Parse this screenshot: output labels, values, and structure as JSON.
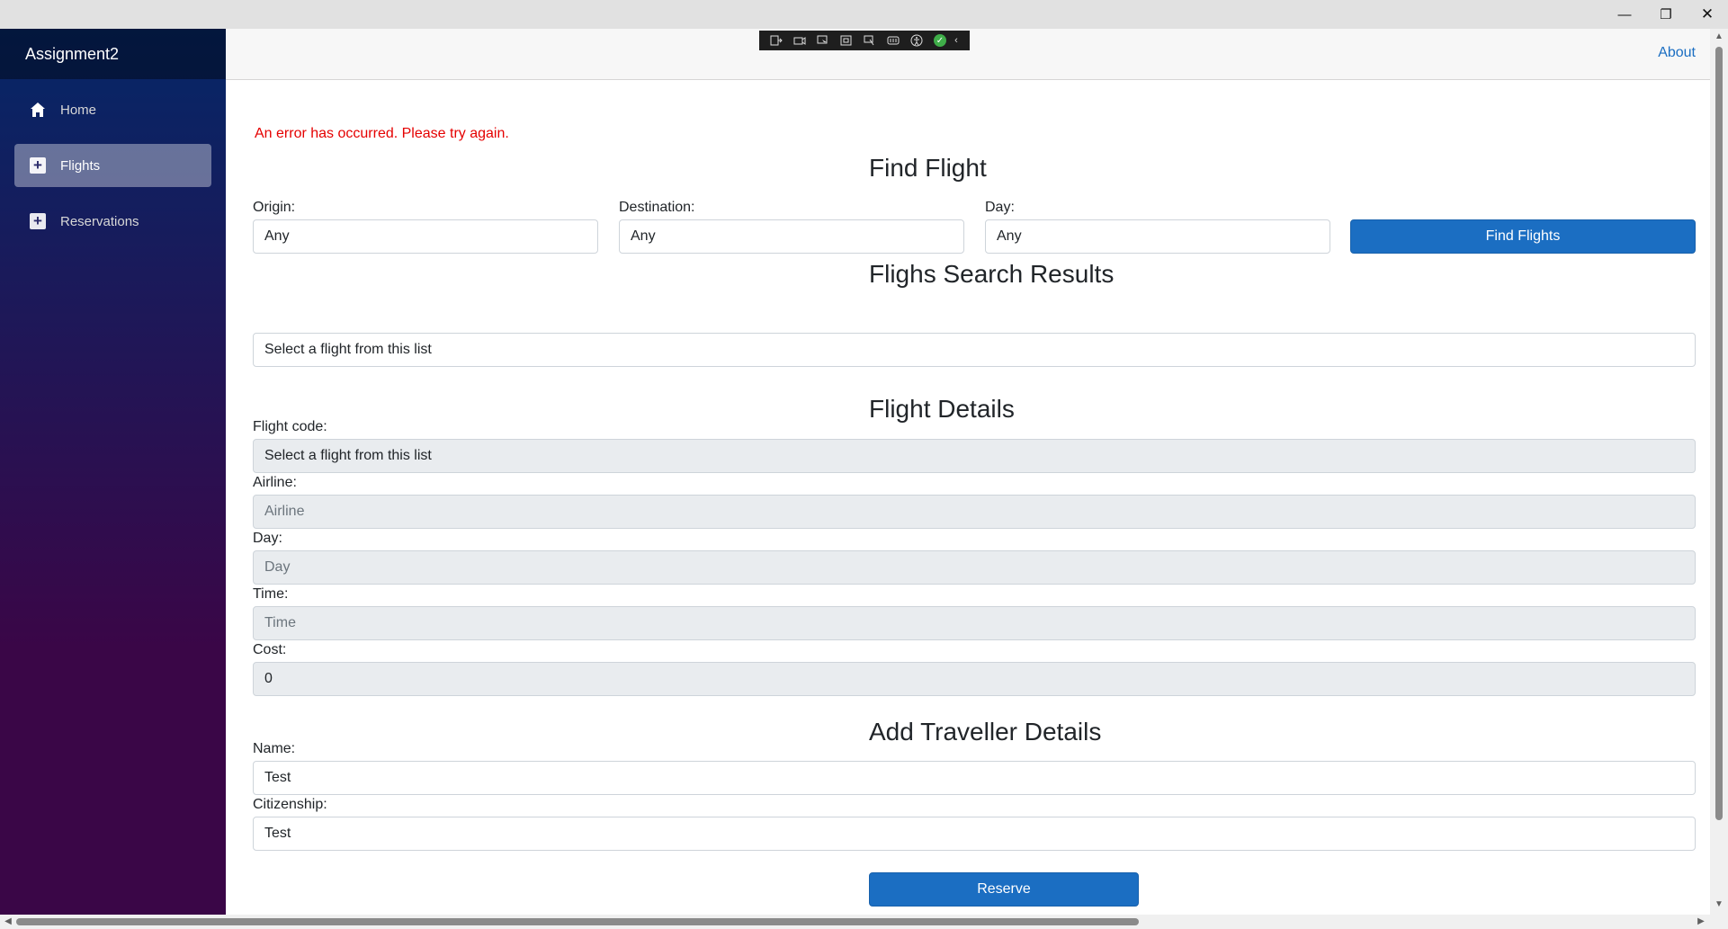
{
  "window": {
    "minimize_glyph": "—",
    "maximize_glyph": "❐",
    "close_glyph": "✕"
  },
  "sidebar": {
    "brand": "Assignment2",
    "items": [
      {
        "label": "Home",
        "icon": "home-icon"
      },
      {
        "label": "Flights",
        "icon": "plus-icon",
        "active": true
      },
      {
        "label": "Reservations",
        "icon": "plus-icon"
      }
    ]
  },
  "topbar": {
    "about": "About"
  },
  "error": "An error has occurred. Please try again.",
  "find": {
    "title": "Find Flight",
    "origin_label": "Origin:",
    "origin_value": "Any",
    "destination_label": "Destination:",
    "destination_value": "Any",
    "day_label": "Day:",
    "day_value": "Any",
    "button": "Find Flights"
  },
  "results": {
    "title": "Flighs Search Results",
    "list_value": "Select a flight from this list"
  },
  "details": {
    "title": "Flight Details",
    "code_label": "Flight code:",
    "code_value": "Select a flight from this list",
    "airline_label": "Airline:",
    "airline_placeholder": "Airline",
    "day_label": "Day:",
    "day_placeholder": "Day",
    "time_label": "Time:",
    "time_placeholder": "Time",
    "cost_label": "Cost:",
    "cost_value": "0"
  },
  "traveller": {
    "title": "Add Traveller Details",
    "name_label": "Name:",
    "name_value": "Test",
    "citizenship_label": "Citizenship:",
    "citizenship_value": "Test",
    "button": "Reserve"
  },
  "colors": {
    "accent": "#1b6ec2",
    "error": "#e50000",
    "sidebar_top": "#052767",
    "sidebar_bottom": "#3a0647"
  }
}
